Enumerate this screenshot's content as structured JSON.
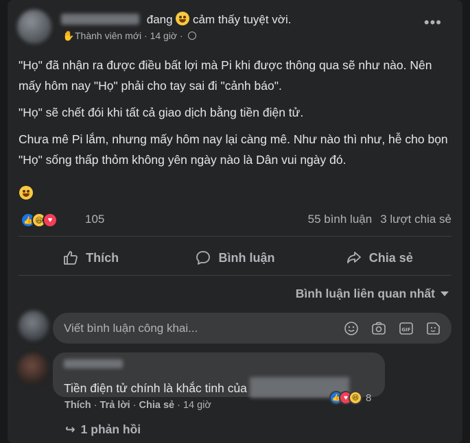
{
  "post": {
    "author_status": "đang",
    "feeling": "cảm thấy tuyệt vời.",
    "member_badge": "Thành viên mới",
    "time": "14 giờ",
    "separator": "·",
    "more_label": "•••",
    "paragraphs": [
      "\"Họ\" đã nhận ra được điều bất lợi mà Pi khi được thông qua sẽ như nào. Nên mấy hôm nay \"Họ\" phải cho tay sai đi \"cảnh báo\".",
      "\"Họ\" sẽ chết đói khi tất cả giao dịch bằng tiền điện tử.",
      "Chưa mê Pi lắm, nhưng mấy hôm nay lại càng mê. Như nào thì như, hễ cho bọn  \"Họ\" sống thấp thỏm không yên ngày nào là Dân vui ngày đó."
    ],
    "reaction_count": "105",
    "comments_count": "55 bình luận",
    "shares_count": "3 lượt chia sẻ"
  },
  "actions": {
    "like": "Thích",
    "comment": "Bình luận",
    "share": "Chia sẻ"
  },
  "sort_label": "Bình luận liên quan nhất",
  "comment_input": {
    "placeholder": "Viết bình luận công khai..."
  },
  "comment": {
    "text": "Tiền điện tử chính là khắc tinh của",
    "reaction_count": "8",
    "like": "Thích",
    "reply": "Trả lời",
    "share": "Chia sẻ",
    "time": "14 giờ",
    "replies": "1 phản hồi"
  },
  "icons": {
    "like": "thumbs-up-icon",
    "comment": "speech-bubble-icon",
    "share": "share-arrow-icon",
    "emoji": "smiley-icon",
    "camera": "camera-icon",
    "gif": "gif-icon",
    "sticker": "sticker-icon"
  },
  "colors": {
    "background": "#18191a",
    "card": "#242526",
    "input": "#3a3b3c",
    "like_blue": "#1b74e4",
    "love_red": "#f33e58",
    "haha_yellow": "#f7c843"
  }
}
